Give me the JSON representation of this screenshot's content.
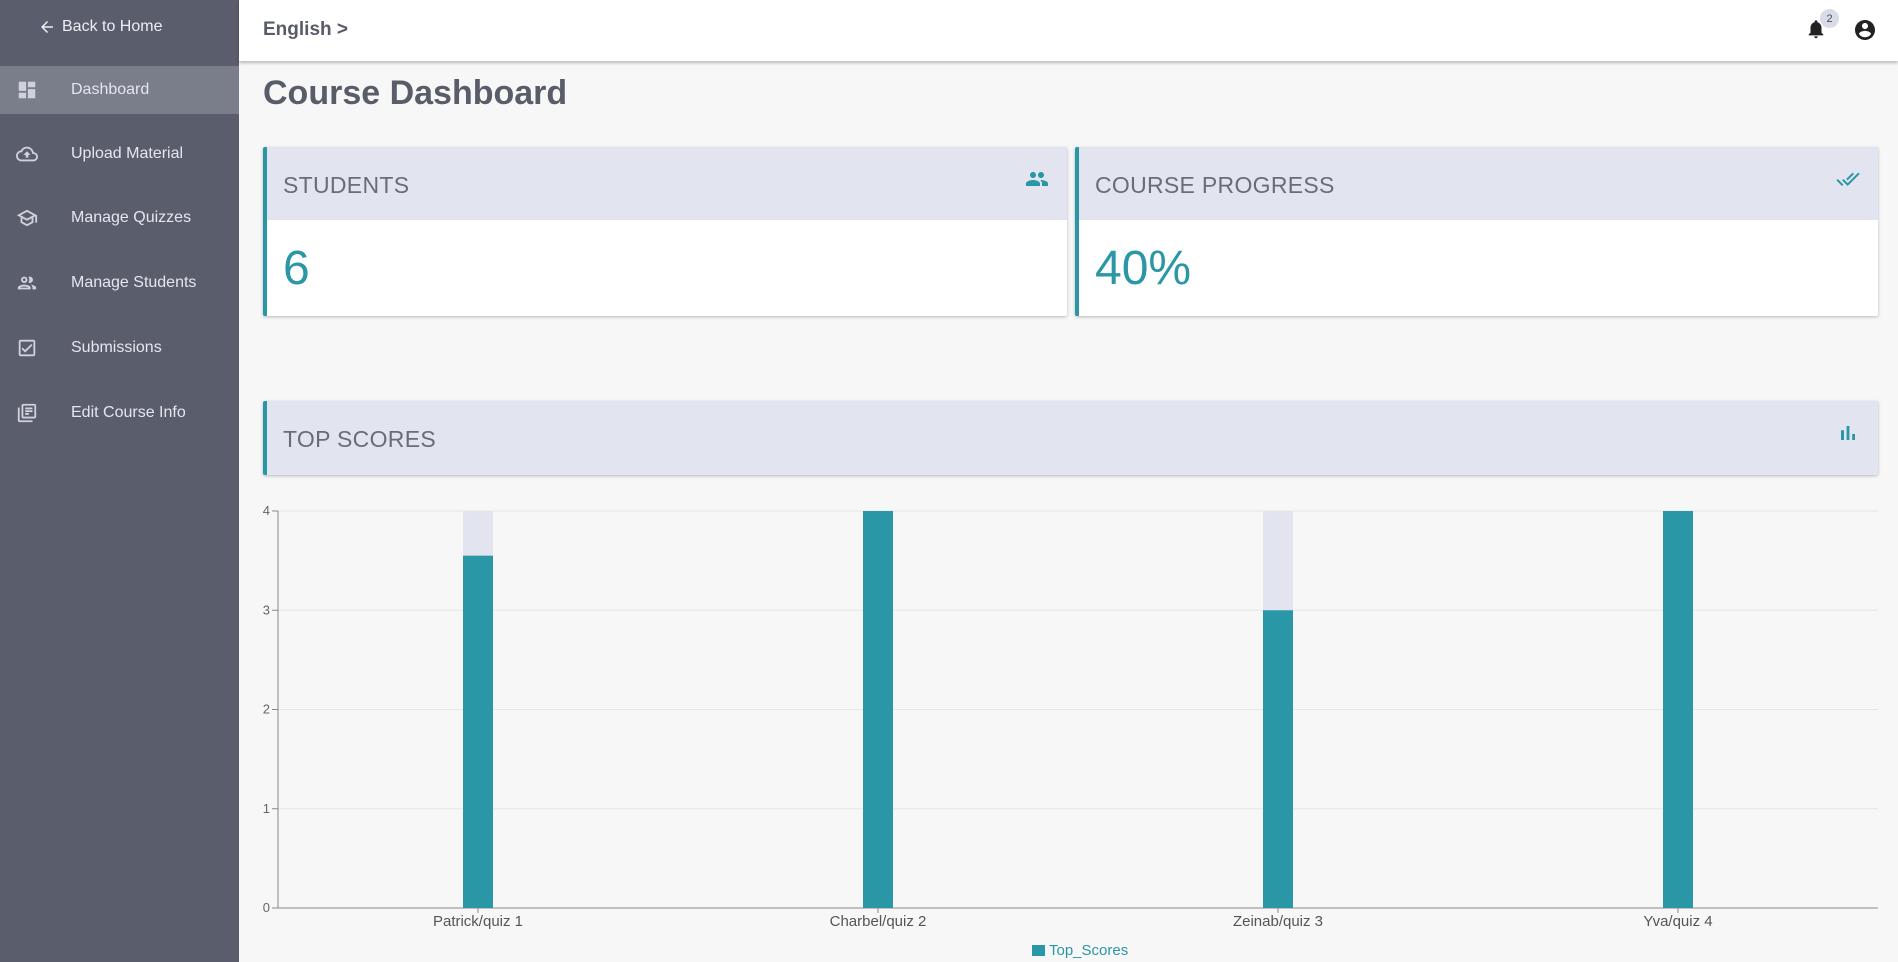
{
  "sidebar": {
    "back_label": "Back to Home",
    "items": [
      {
        "label": "Dashboard",
        "icon": "dashboard-icon"
      },
      {
        "label": "Upload Material",
        "icon": "cloud-upload-icon"
      },
      {
        "label": "Manage Quizzes",
        "icon": "school-icon"
      },
      {
        "label": "Manage Students",
        "icon": "people-icon"
      },
      {
        "label": "Submissions",
        "icon": "checkbox-icon"
      },
      {
        "label": "Edit Course Info",
        "icon": "library-books-icon"
      }
    ]
  },
  "topbar": {
    "breadcrumb": "English >",
    "notification_count": "2"
  },
  "main": {
    "title": "Course Dashboard",
    "cards": [
      {
        "title": "STUDENTS",
        "value": "6",
        "icon": "people-icon"
      },
      {
        "title": "COURSE PROGRESS",
        "value": "40%",
        "icon": "done-all-icon"
      }
    ],
    "section_title": "TOP SCORES",
    "section_icon": "bar-chart-icon"
  },
  "colors": {
    "accent": "#2a97a6",
    "sidebar": "#5a5d6b",
    "card_header": "#e2e4ef"
  },
  "chart_data": {
    "type": "bar",
    "categories": [
      "Patrick/quiz 1",
      "Charbel/quiz 2",
      "Zeinab/quiz 3",
      "Yva/quiz 4"
    ],
    "series": [
      {
        "name": "Top_Scores",
        "values": [
          3.55,
          4,
          3,
          4
        ]
      }
    ],
    "background_max": 4,
    "ylim": [
      0,
      4
    ],
    "yticks": [
      0,
      1,
      2,
      3,
      4
    ],
    "grid": true,
    "legend": "bottom-center"
  }
}
